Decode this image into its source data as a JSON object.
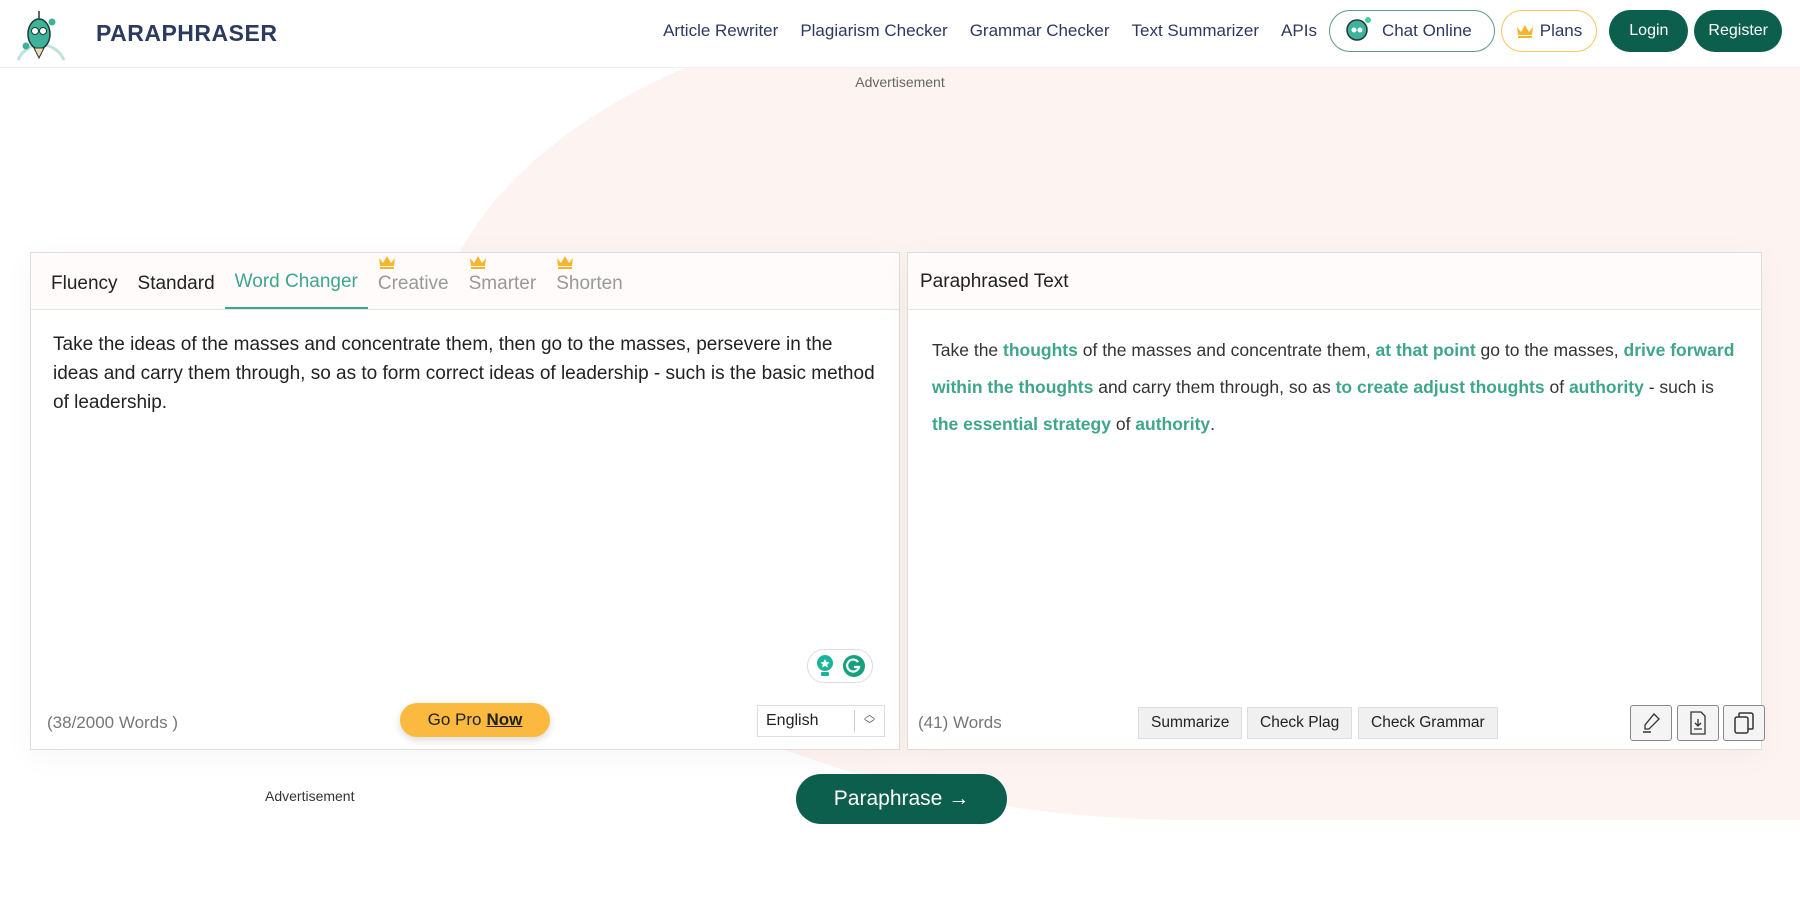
{
  "header": {
    "brand": "PARAPHRASER",
    "nav": [
      "Article Rewriter",
      "Plagiarism Checker",
      "Grammar Checker",
      "Text Summarizer",
      "APIs"
    ],
    "chat": "Chat Online",
    "plans": "Plans",
    "login": "Login",
    "register": "Register"
  },
  "ads": {
    "top": "Advertisement",
    "bottom": "Advertisement"
  },
  "input": {
    "tabs": [
      {
        "label": "Fluency"
      },
      {
        "label": "Standard"
      },
      {
        "label": "Word Changer",
        "active": true
      },
      {
        "label": "Creative",
        "pro": true
      },
      {
        "label": "Smarter",
        "pro": true
      },
      {
        "label": "Shorten",
        "pro": true
      }
    ],
    "text": "Take the ideas of the masses and concentrate them, then go to the masses, persevere in the ideas and carry them through, so as to form correct ideas of leadership - such is the basic method of leadership.",
    "word_count": "(38/2000 Words )",
    "go_pro": "Go Pro",
    "go_pro_now": "Now",
    "language": "English"
  },
  "output": {
    "title": "Paraphrased Text",
    "segments": [
      {
        "t": "Take the ",
        "h": false
      },
      {
        "t": "thoughts",
        "h": true
      },
      {
        "t": " of the masses and concentrate them, ",
        "h": false
      },
      {
        "t": "at that point",
        "h": true
      },
      {
        "t": " go to the masses, ",
        "h": false
      },
      {
        "t": "drive forward within the thoughts",
        "h": true
      },
      {
        "t": " and carry them through, so as ",
        "h": false
      },
      {
        "t": "to create adjust thoughts",
        "h": true
      },
      {
        "t": " of ",
        "h": false
      },
      {
        "t": "authority",
        "h": true
      },
      {
        "t": " - such is ",
        "h": false
      },
      {
        "t": "the essential strategy",
        "h": true
      },
      {
        "t": " of ",
        "h": false
      },
      {
        "t": "authority",
        "h": true
      },
      {
        "t": ".",
        "h": false
      }
    ],
    "word_count": "(41) Words",
    "actions": [
      "Summarize",
      "Check Plag",
      "Check Grammar"
    ],
    "icons": [
      "highlighter-icon",
      "download-icon",
      "copy-icon"
    ]
  },
  "paraphrase_button": "Paraphrase →",
  "colors": {
    "accent": "#3fa68a",
    "dark_green": "#0c5f4d",
    "gold": "#fbb93f",
    "navy": "#2d3a5e"
  }
}
